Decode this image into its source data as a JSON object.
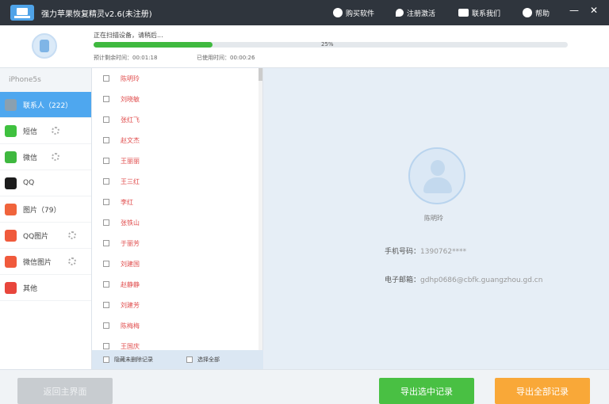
{
  "titlebar": {
    "title": "强力苹果恢复精灵v2.6(未注册)",
    "buttons": [
      {
        "label": "购买软件",
        "icon": "shop-icon"
      },
      {
        "label": "注册激活",
        "icon": "key-icon"
      },
      {
        "label": "联系我们",
        "icon": "chat-icon"
      },
      {
        "label": "帮助",
        "icon": "help-icon"
      }
    ],
    "minimize": "—",
    "close": "✕"
  },
  "scan": {
    "status": "正在扫描设备，请稍后...",
    "progress": 0.25,
    "percent_label": "25%",
    "time_left": "预计剩余时间：00:01:18",
    "time_used": "已使用时间：00:00:26"
  },
  "sidebar": {
    "device": "iPhone5s",
    "items": [
      {
        "label": "联系人（222）",
        "icon": "contacts-icon",
        "color": "#8aa0b0",
        "active": true,
        "loading": false
      },
      {
        "label": "短信",
        "icon": "sms-icon",
        "color": "#3fc13f",
        "active": false,
        "loading": true
      },
      {
        "label": "微信",
        "icon": "wechat-icon",
        "color": "#3fb83f",
        "active": false,
        "loading": true
      },
      {
        "label": "QQ",
        "icon": "qq-icon",
        "color": "#1c1c1c",
        "active": false,
        "loading": false
      },
      {
        "label": "图片（79）",
        "icon": "photos-icon",
        "color": "#f0643c",
        "active": false,
        "loading": false
      },
      {
        "label": "QQ图片",
        "icon": "qq-photos-icon",
        "color": "#f05a3c",
        "active": false,
        "loading": true
      },
      {
        "label": "微信图片",
        "icon": "wechat-photos-icon",
        "color": "#f05a3c",
        "active": false,
        "loading": true
      },
      {
        "label": "其他",
        "icon": "other-icon",
        "color": "#e8463c",
        "active": false,
        "loading": false
      }
    ]
  },
  "list": {
    "rows": [
      "陈明玲",
      "刘晓敏",
      "张红飞",
      "赵文杰",
      "王丽丽",
      "王三红",
      "李红",
      "张铁山",
      "于丽芳",
      "刘建国",
      "赵静静",
      "刘建芳",
      "陈梅梅",
      "王国庆"
    ],
    "footer_hide_deleted": "隐藏未删除记录",
    "footer_select_all": "选择全部"
  },
  "detail": {
    "name": "陈明玲",
    "phone_label": "手机号码：",
    "phone_value": "1390762****",
    "email_label": "电子邮箱：",
    "email_value": "gdhp0686@cbfk.guangzhou.gd.cn"
  },
  "bottom": {
    "back_label": "返回主界面",
    "export_selected_label": "导出选中记录",
    "export_all_label": "导出全部记录"
  },
  "colors": {
    "titlebar": "#2f353d",
    "accent": "#4ea7ef",
    "progress": "#3fb93f",
    "export_selected": "#49c043",
    "export_all": "#f9a838",
    "deleted_text": "#e04c4c"
  }
}
